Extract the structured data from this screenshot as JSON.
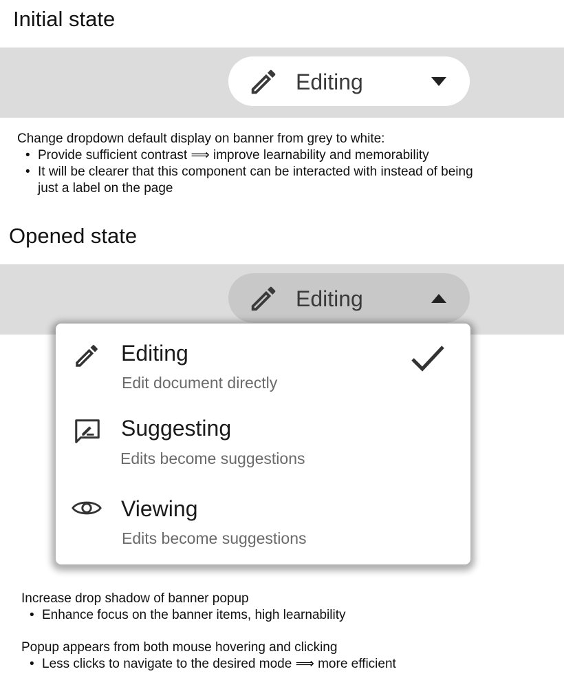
{
  "sections": {
    "initial": {
      "title": "Initial state",
      "dropdown": {
        "label": "Editing",
        "icon": "pencil-icon",
        "caret": "caret-down-icon"
      },
      "note": {
        "lead": "Change dropdown default display on banner from grey to white:",
        "bullets": [
          "Provide sufficient contrast ⟹ improve learnability and memorability",
          "It will be clearer that this component can be interacted with instead of being just a label on the page"
        ]
      }
    },
    "opened": {
      "title": "Opened state",
      "dropdown": {
        "label": "Editing",
        "icon": "pencil-icon",
        "caret": "caret-up-icon"
      },
      "menu": {
        "options": [
          {
            "title": "Editing",
            "subtitle": "Edit document directly",
            "icon": "pencil-icon",
            "selected": true
          },
          {
            "title": "Suggesting",
            "subtitle": "Edits become suggestions",
            "icon": "suggest-icon",
            "selected": false
          },
          {
            "title": "Viewing",
            "subtitle": "Edits become suggestions",
            "icon": "eye-icon",
            "selected": false
          }
        ]
      },
      "notes": [
        {
          "lead": "Increase drop shadow of banner popup",
          "bullets": [
            "Enhance focus on the banner items, high learnability"
          ]
        },
        {
          "lead": "Popup appears from both mouse hovering and clicking",
          "bullets": [
            "Less clicks to navigate to the desired mode ⟹ more efficient"
          ]
        }
      ]
    }
  },
  "colors": {
    "banner": "#dcdcdc",
    "dropdown_default": "#ffffff",
    "dropdown_open": "#c8c8c8",
    "text": "#111111",
    "subtext": "#6a6a6a"
  }
}
